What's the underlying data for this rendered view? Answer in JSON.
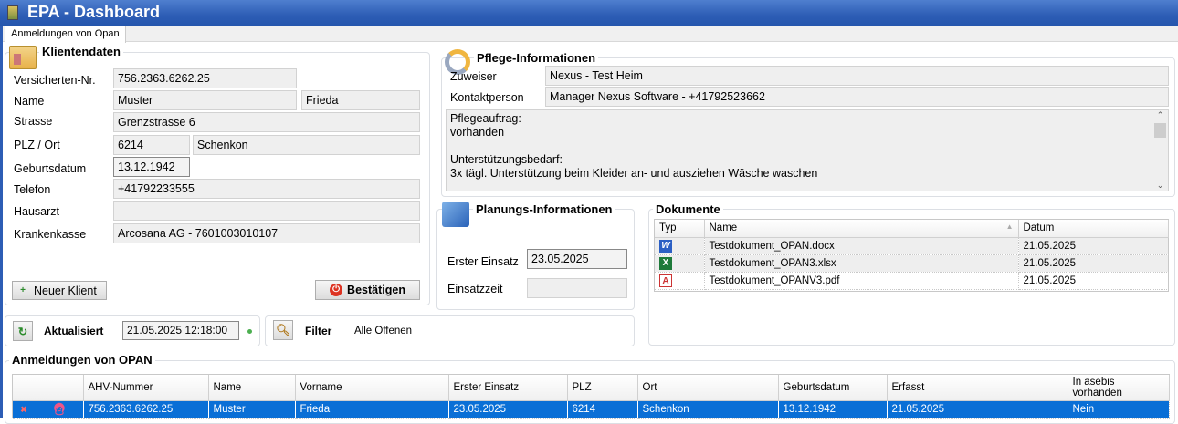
{
  "window": {
    "title": "EPA - Dashboard"
  },
  "tabs": [
    {
      "label": "Anmeldungen von Opan"
    }
  ],
  "client": {
    "title": "Klientendaten",
    "labels": {
      "insurance_no": "Versicherten-Nr.",
      "name": "Name",
      "street": "Strasse",
      "zip_city": "PLZ / Ort",
      "birthdate": "Geburtsdatum",
      "phone": "Telefon",
      "doctor": "Hausarzt",
      "insurer": "Krankenkasse"
    },
    "values": {
      "insurance_no": "756.2363.6262.25",
      "last_name": "Muster",
      "first_name": "Frieda",
      "street": "Grenzstrasse 6",
      "zip": "6214",
      "city": "Schenkon",
      "birthdate": "13.12.1942",
      "phone": "+41792233555",
      "doctor": "",
      "insurer": "Arcosana AG - 7601003010107"
    },
    "new_client_label": "Neuer Klient",
    "confirm_label": "Bestätigen"
  },
  "care": {
    "title": "Pflege-Informationen",
    "referrer_label": "Zuweiser",
    "referrer": "Nexus - Test Heim",
    "contact_label": "Kontaktperson",
    "contact": "Manager Nexus Software - +41792523662",
    "notes": "Pflegeauftrag:\nvorhanden\n\nUnterstützungsbedarf:\n3x tägl. Unterstützung beim Kleider an- und ausziehen Wäsche waschen"
  },
  "planning": {
    "title": "Planungs-Informationen",
    "first_label": "Erster Einsatz",
    "first": "23.05.2025",
    "time_label": "Einsatzzeit",
    "time": ""
  },
  "documents": {
    "title": "Dokumente",
    "columns": [
      "Typ",
      "Name",
      "Datum"
    ],
    "rows": [
      {
        "type": "word",
        "name": "Testdokument_OPAN.docx",
        "date": "21.05.2025"
      },
      {
        "type": "excel",
        "name": "Testdokument_OPAN3.xlsx",
        "date": "21.05.2025"
      },
      {
        "type": "pdf",
        "name": "Testdokument_OPANV3.pdf",
        "date": "21.05.2025"
      }
    ]
  },
  "status": {
    "updated_label": "Aktualisiert",
    "updated": "21.05.2025 12:18:00",
    "filter_label": "Filter",
    "filter": "Alle Offenen",
    "indicator_color": "#4caf50"
  },
  "registrations": {
    "title": "Anmeldungen von OPAN",
    "columns": [
      "",
      "",
      "AHV-Nummer",
      "Name",
      "Vorname",
      "Erster Einsatz",
      "PLZ",
      "Ort",
      "Geburtsdatum",
      "Erfasst",
      "In asebis vorhanden"
    ],
    "rows": [
      {
        "ahv": "756.2363.6262.25",
        "name": "Muster",
        "first": "Frieda",
        "start": "23.05.2025",
        "zip": "6214",
        "city": "Schenkon",
        "birth": "13.12.1942",
        "created": "21.05.2025",
        "in_asebis": "Nein"
      }
    ]
  },
  "colors": {
    "titlebar": "#2d5db5",
    "selection": "#0a6fd6"
  }
}
